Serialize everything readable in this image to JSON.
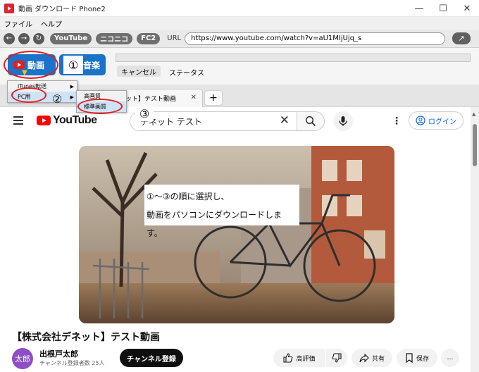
{
  "window": {
    "title": "動画 ダウンロード Phone2",
    "minimize": "—",
    "maximize": "☐",
    "close": "✕"
  },
  "menu": {
    "file": "ファイル",
    "help": "ヘルプ"
  },
  "toolbar": {
    "back": "←",
    "forward": "→",
    "reload": "↻",
    "sites": [
      "YouTube",
      "ニコニコ",
      "FC2"
    ],
    "url_label": "URL",
    "url_value": "https://www.youtube.com/watch?v=aU1MIjUjq_s",
    "go": "↗"
  },
  "actions": {
    "video_label": "動画",
    "music_label": "音楽",
    "cancel_label": "キャンセル",
    "status_label": "ステータス",
    "progress_fraction": 0
  },
  "context_menu": {
    "items": [
      "iTunes転送",
      "PC用"
    ],
    "submenu_items": [
      "高画質",
      "標準画質"
    ]
  },
  "annotations": {
    "step1": "①",
    "step2": "②",
    "step3": "③"
  },
  "browser_tab": {
    "title": "【株式会社デネット】テスト動画",
    "close": "✕",
    "add": "+"
  },
  "youtube": {
    "logo_text": "YouTube",
    "search_value": "デネット テスト",
    "search_clear": "✕",
    "login_label": "ログイン",
    "overlay_line1": "①～③の順に選択し、",
    "overlay_line2": "動画をパソコンにダウンロードします。",
    "video_title": "【株式会社デネット】テスト動画",
    "channel_avatar": "太郎",
    "channel_name": "出根戸太郎",
    "channel_subs": "チャンネル登録者数 25人",
    "subscribe_label": "チャンネル登録",
    "like_label": "高評価",
    "share_label": "共有",
    "save_label": "保存",
    "more_label": "…"
  },
  "colors": {
    "accent_blue": "#1a73c9",
    "highlight_red": "#e31b23",
    "youtube_red": "#ff0000",
    "link_blue": "#065fd4"
  }
}
